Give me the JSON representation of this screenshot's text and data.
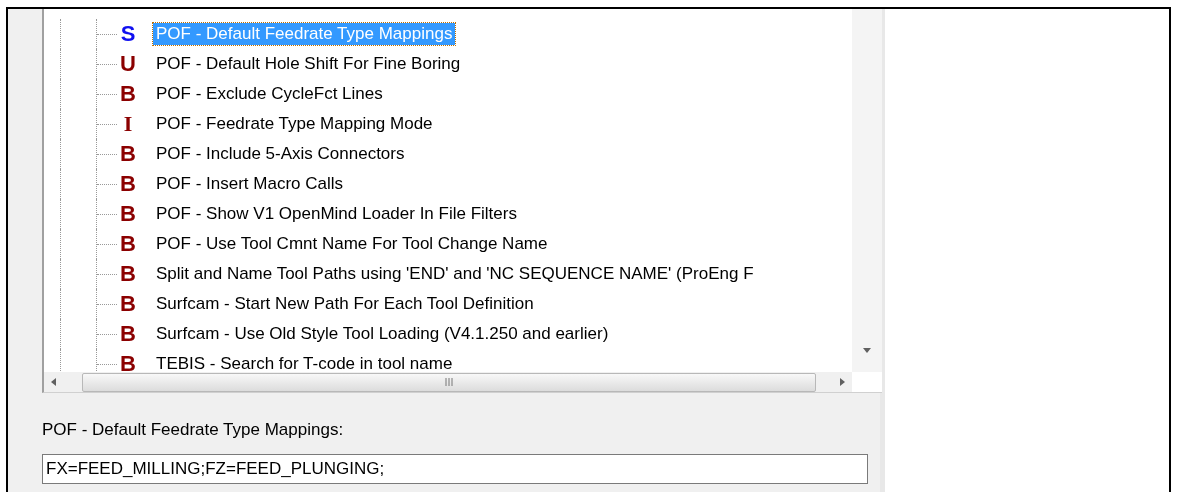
{
  "tree": {
    "items": [
      {
        "kind": "string",
        "type": "S",
        "label": "POF - Default Feedrate Type Mappings",
        "selected": true
      },
      {
        "kind": "unsigned",
        "type": "U",
        "label": "POF - Default Hole Shift For Fine Boring",
        "selected": false
      },
      {
        "kind": "bool",
        "type": "B",
        "label": "POF - Exclude CycleFct Lines",
        "selected": false
      },
      {
        "kind": "integer",
        "type": "I",
        "label": "POF - Feedrate Type Mapping Mode",
        "selected": false
      },
      {
        "kind": "bool",
        "type": "B",
        "label": "POF - Include 5-Axis Connectors",
        "selected": false
      },
      {
        "kind": "bool",
        "type": "B",
        "label": "POF - Insert Macro Calls",
        "selected": false
      },
      {
        "kind": "bool",
        "type": "B",
        "label": "POF - Show V1 OpenMind Loader In File Filters",
        "selected": false
      },
      {
        "kind": "bool",
        "type": "B",
        "label": "POF - Use Tool Cmnt Name For Tool Change Name",
        "selected": false
      },
      {
        "kind": "bool",
        "type": "B",
        "label": "Split and Name Tool Paths using 'END' and 'NC SEQUENCE NAME' (ProEng F",
        "selected": false
      },
      {
        "kind": "bool",
        "type": "B",
        "label": "Surfcam - Start New Path For Each Tool Definition",
        "selected": false
      },
      {
        "kind": "bool",
        "type": "B",
        "label": "Surfcam - Use Old Style Tool Loading (V4.1.250 and earlier)",
        "selected": false
      },
      {
        "kind": "bool",
        "type": "B",
        "label": "TEBIS - Search for T-code in tool name",
        "selected": false
      }
    ]
  },
  "value_label": "POF - Default Feedrate Type Mappings:",
  "value_field": {
    "value": "FX=FEED_MILLING;FZ=FEED_PLUNGING;"
  }
}
